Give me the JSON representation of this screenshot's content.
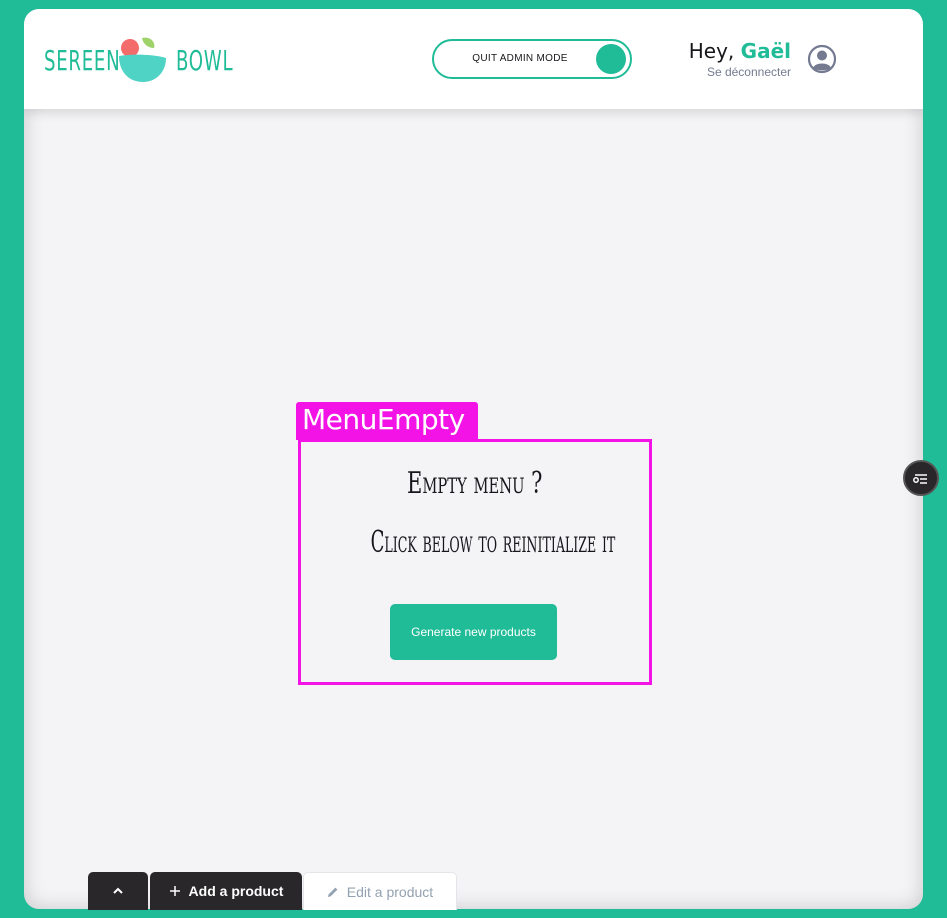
{
  "brand": {
    "word_left": "SEREEN",
    "word_right": "BOWL",
    "accent_color": "#1fbc97",
    "logo_icon": "bowl-logo-icon"
  },
  "navbar": {
    "admin_toggle_label": "QUIT ADMIN MODE",
    "admin_mode_on": true,
    "greeting_prefix": "Hey,",
    "user_name": "Gaël",
    "logout_label": "Se déconnecter",
    "avatar_icon": "user-circle-icon"
  },
  "debug_overlay": {
    "component_label": "MenuEmpty",
    "color": "#f313e6"
  },
  "empty_menu": {
    "title": "Empty menu ?",
    "subtitle": "Click below to reinitialize it",
    "generate_button_label": "Generate new products"
  },
  "side_panel": {
    "icon": "filter-list-icon"
  },
  "admin_panel": {
    "collapse_icon": "chevron-up-icon",
    "tabs": [
      {
        "label": "Add a product",
        "icon": "plus-icon",
        "active": true
      },
      {
        "label": "Edit a product",
        "icon": "pencil-icon",
        "active": false
      }
    ]
  }
}
